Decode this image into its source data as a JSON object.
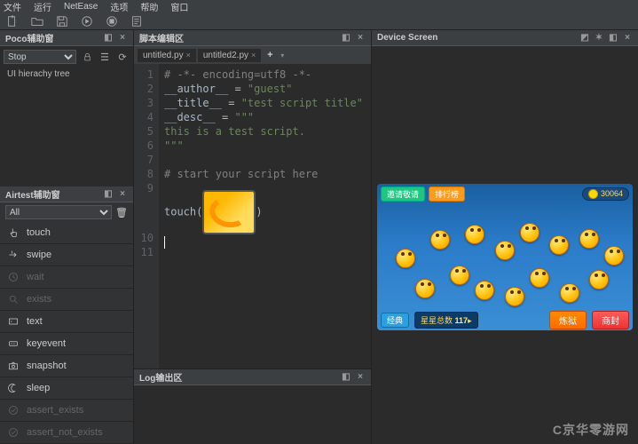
{
  "menu": [
    "文件",
    "运行",
    "NetEase",
    "选项",
    "帮助",
    "窗口"
  ],
  "panels": {
    "poco": {
      "title": "Poco辅助窗",
      "mode": "Stop",
      "hierarchy": "UI hierachy tree"
    },
    "airtest": {
      "title": "Airtest辅助窗",
      "filter": "All"
    },
    "script": {
      "title": "脚本编辑区"
    },
    "log": {
      "title": "Log输出区"
    },
    "device": {
      "title": "Device Screen"
    }
  },
  "airtest_items": [
    {
      "label": "touch",
      "icon": "touch",
      "dim": false
    },
    {
      "label": "swipe",
      "icon": "swipe",
      "dim": false
    },
    {
      "label": "wait",
      "icon": "wait",
      "dim": true
    },
    {
      "label": "exists",
      "icon": "exists",
      "dim": true
    },
    {
      "label": "text",
      "icon": "text",
      "dim": false
    },
    {
      "label": "keyevent",
      "icon": "keyevent",
      "dim": false
    },
    {
      "label": "snapshot",
      "icon": "snapshot",
      "dim": false
    },
    {
      "label": "sleep",
      "icon": "sleep",
      "dim": false
    },
    {
      "label": "assert_exists",
      "icon": "assert",
      "dim": true
    },
    {
      "label": "assert_not_exists",
      "icon": "assert",
      "dim": true
    }
  ],
  "tabs": [
    {
      "label": "untitled.py"
    },
    {
      "label": "untitled2.py"
    }
  ],
  "code": {
    "line1": "# -*- encoding=utf8 -*-",
    "line2a": "__author__ = ",
    "line2b": "\"guest\"",
    "line3a": "__title__ = ",
    "line3b": "\"test script title\"",
    "line4a": "__desc__ = ",
    "line4b": "\"\"\"",
    "line5": "this is a test script.",
    "line6": "\"\"\"",
    "line8": "# start your script here",
    "line10a": "touch(",
    "line10b": ")"
  },
  "line_numbers": [
    "1",
    "2",
    "3",
    "4",
    "5",
    "6",
    "7",
    "8",
    "9",
    "",
    "10",
    "11"
  ],
  "game": {
    "top_btn1": "邀请敬请",
    "top_btn2": "排行榜",
    "star_label": "星星总数",
    "star_value": "117",
    "coins": "30064",
    "btn_left": "炼狱",
    "btn_right": "商封",
    "tag": "经典"
  },
  "watermark": "C京华零游网"
}
